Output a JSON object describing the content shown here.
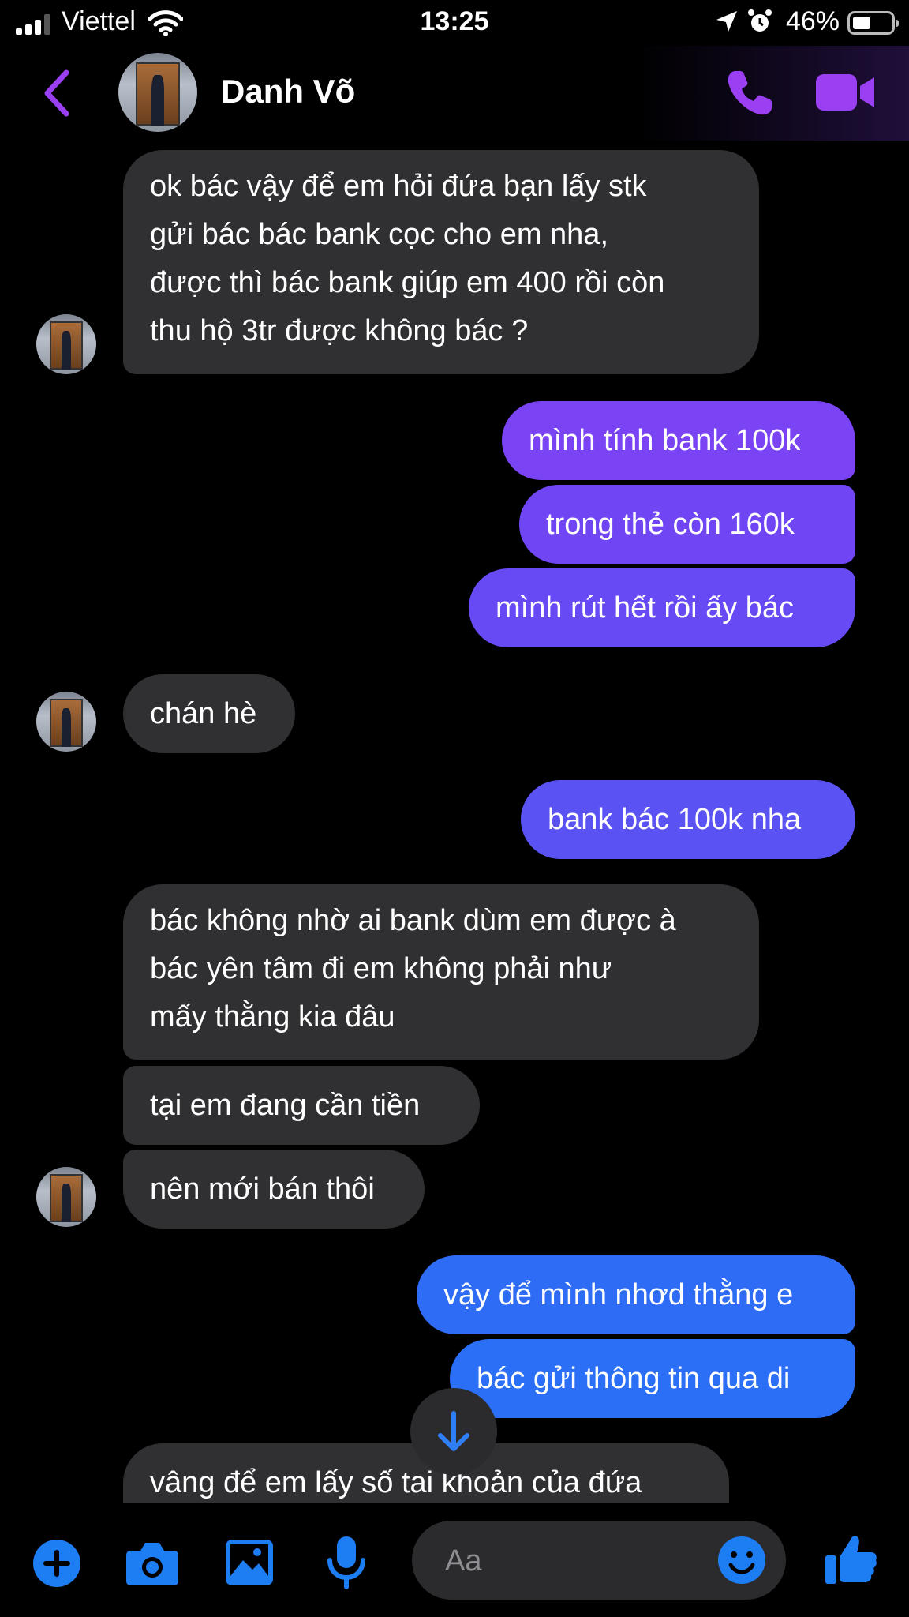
{
  "status_bar": {
    "carrier": "Viettel",
    "time": "13:25",
    "battery": "46%"
  },
  "header": {
    "contact_name": "Danh Võ"
  },
  "messages": [
    {
      "from": "them",
      "text": "ok bác vậy để em hỏi đứa bạn lấy stk\ngửi bác bác bank cọc cho em nha,\nđược thì bác bank giúp em 400 rồi còn\nthu hộ 3tr được  không bác ?"
    },
    {
      "from": "me",
      "text": "mình tính bank 100k"
    },
    {
      "from": "me",
      "text": "trong thẻ còn 160k"
    },
    {
      "from": "me",
      "text": "mình rút hết rồi ấy bác"
    },
    {
      "from": "them",
      "text": "chán hè"
    },
    {
      "from": "me",
      "text": "bank bác 100k nha"
    },
    {
      "from": "them",
      "text": "bác không nhờ ai bank dùm em được à\nbác yên tâm đi em không phải như\nmấy thằng kia đâu"
    },
    {
      "from": "them",
      "text": "tại em đang cần tiền"
    },
    {
      "from": "them",
      "text": "nên mới bán thôi"
    },
    {
      "from": "me",
      "text": "vậy để mình nhơd thằng e"
    },
    {
      "from": "me",
      "text": "bác gửi thông tin qua di"
    },
    {
      "from": "them",
      "text": "vâng để em lấy số tai khoản của đứa"
    }
  ],
  "composer": {
    "placeholder": "Aa"
  },
  "colors": {
    "accent": "#9b3ff2",
    "bubble_incoming": "#303033",
    "bubble_out_purple": "#7a44f5",
    "bubble_out_indigo": "#5a52f3",
    "bubble_out_blue": "#2e6cf5",
    "composer_blue": "#1d7df2"
  },
  "icons": {
    "back": "chevron-left-icon",
    "call": "phone-icon",
    "video": "video-camera-icon",
    "scroll_down": "arrow-down-icon",
    "add": "plus-circle-icon",
    "camera": "camera-icon",
    "gallery": "image-icon",
    "mic": "microphone-icon",
    "emoji": "smiley-icon",
    "like": "thumbs-up-icon"
  }
}
